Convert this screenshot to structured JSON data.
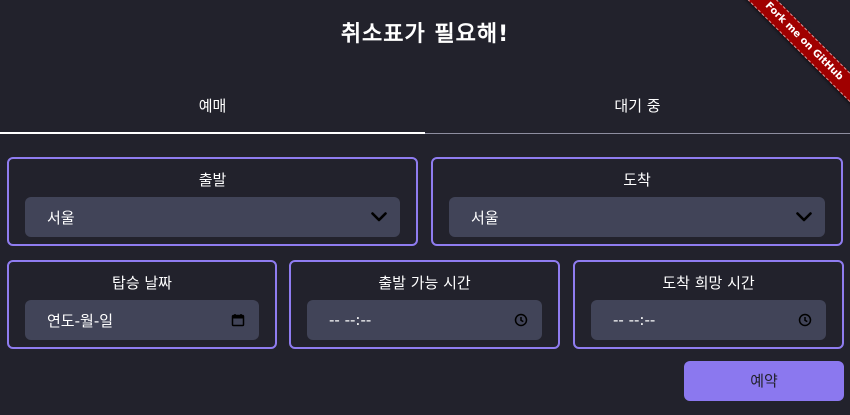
{
  "header": {
    "title": "취소표가 필요해!"
  },
  "ribbon": {
    "text": "Fork me on GitHub"
  },
  "tabs": [
    {
      "label": "예매",
      "active": true
    },
    {
      "label": "대기 중",
      "active": false
    }
  ],
  "departure": {
    "label": "출발",
    "value": "서울"
  },
  "arrival": {
    "label": "도착",
    "value": "서울"
  },
  "date": {
    "label": "탑승 날짜",
    "value": "연도-월-일"
  },
  "depart_time": {
    "label": "출발 가능 시간",
    "value": "-- --:--"
  },
  "arrive_time": {
    "label": "도착 희망 시간",
    "value": "-- --:--"
  },
  "submit": {
    "label": "예약"
  },
  "colors": {
    "background": "#22222c",
    "accent": "#8b78ef",
    "input_bg": "#414458",
    "ribbon": "#a00000"
  },
  "icons": {
    "select_arrow": "chevron-down-icon",
    "date": "calendar-icon",
    "time": "clock-icon"
  }
}
